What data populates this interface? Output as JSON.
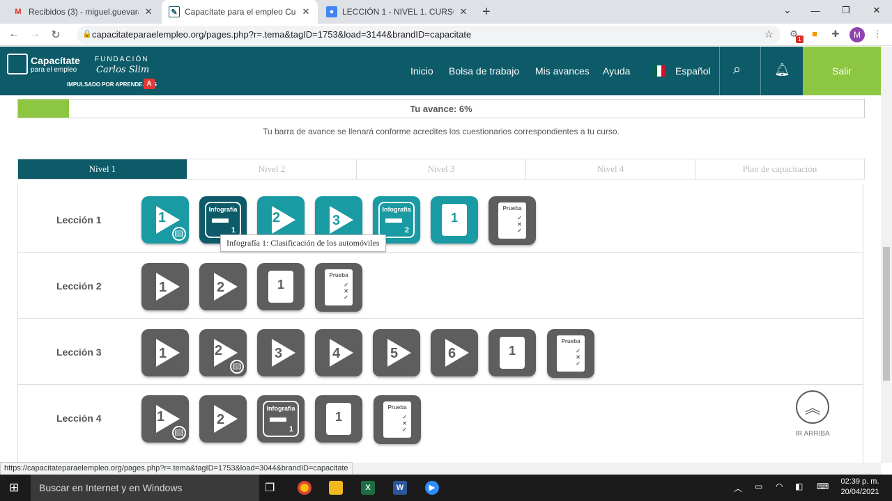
{
  "browser": {
    "tabs": [
      {
        "title": "Recibidos (3) - miguel.guevara@",
        "icon": "gmail-icon"
      },
      {
        "title": "Capacítate para el empleo Curso",
        "icon": "page-edit-icon"
      },
      {
        "title": "LECCIÓN 1 - NIVEL 1. CURSO ME",
        "icon": "account-icon"
      }
    ],
    "url": "capacitateparaelempleo.org/pages.php?r=.tema&tagID=1753&load=3144&brandID=capacitate",
    "profile_initial": "M",
    "extension_badge": "1",
    "status_url": "https://capacitateparaelempleo.org/pages.php?r=.tema&tagID=1753&load=3044&brandID=capacitate"
  },
  "site": {
    "logo_main": "Capacítate",
    "logo_sub": "para el empleo",
    "logo_foundation": "FUNDACIÓN",
    "logo_signature": "Carlos Slim",
    "logo_powered": "IMPULSADO POR APRENDE.ORG",
    "nav": [
      "Inicio",
      "Bolsa de trabajo",
      "Mis avances",
      "Ayuda"
    ],
    "language": "Español",
    "logout": "Salir",
    "accent_color": "#0d5a68",
    "green_color": "#8dc641"
  },
  "progress": {
    "label": "Tu avance: 6%",
    "percent": 6,
    "note": "Tu barra de avance se llenará conforme acredites los cuestionarios correspondientes a tu curso."
  },
  "levels": [
    "Nivel 1",
    "Nivel 2",
    "Nivel 3",
    "Nivel 4",
    "Plan de capacitación"
  ],
  "lessons": [
    {
      "title": "Lección 1"
    },
    {
      "title": "Lección 2"
    },
    {
      "title": "Lección 3"
    },
    {
      "title": "Lección 4"
    }
  ],
  "labels": {
    "infografia": "Infografía",
    "prueba": "Prueba",
    "one": "1",
    "two": "2",
    "three": "3",
    "four": "4",
    "five": "5",
    "six": "6"
  },
  "tooltip": "Infografía 1: Clasificación de los automóviles",
  "go_up": "IR ARRIBA",
  "taskbar": {
    "search": "Buscar en Internet y en Windows",
    "time": "02:39 p. m.",
    "date": "20/04/2021"
  }
}
